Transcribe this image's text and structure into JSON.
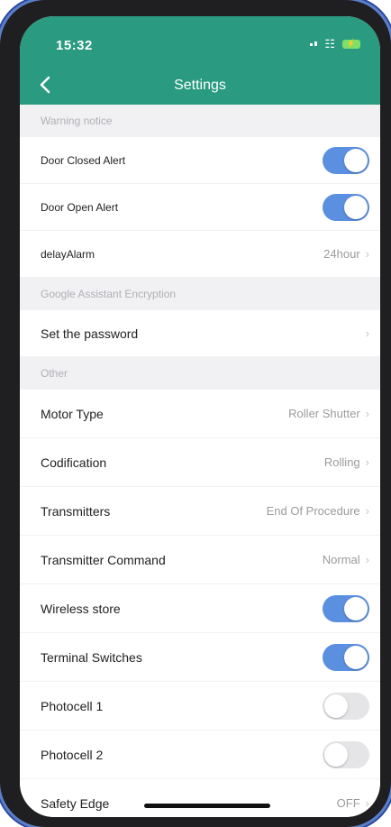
{
  "status": {
    "time": "15:32"
  },
  "header": {
    "title": "Settings"
  },
  "sections": {
    "warning": "Warning notice",
    "google": "Google Assistant Encryption",
    "other": "Other"
  },
  "rows": {
    "door_closed": {
      "label": "Door Closed Alert",
      "state": "on"
    },
    "door_open": {
      "label": "Door Open Alert",
      "state": "on"
    },
    "delay_alarm": {
      "label": "delayAlarm",
      "value": "24hour"
    },
    "set_password": {
      "label": "Set the password"
    },
    "motor_type": {
      "label": "Motor Type",
      "value": "Roller Shutter"
    },
    "codification": {
      "label": "Codification",
      "value": "Rolling"
    },
    "transmitters": {
      "label": "Transmitters",
      "value": "End Of Procedure"
    },
    "transmitter_command": {
      "label": "Transmitter Command",
      "value": "Normal"
    },
    "wireless_store": {
      "label": "Wireless store",
      "state": "on"
    },
    "terminal_switches": {
      "label": "Terminal Switches",
      "state": "on"
    },
    "photocell_1": {
      "label": "Photocell 1",
      "state": "off"
    },
    "photocell_2": {
      "label": "Photocell 2",
      "state": "off"
    },
    "safety_edge": {
      "label": "Safety Edge",
      "value": "OFF"
    }
  },
  "icons": {
    "back": "chevron-left-icon",
    "chevron": "chevron-right-icon",
    "signal": "signal-icon",
    "wifi": "wifi-icon",
    "battery": "battery-charging-icon"
  },
  "colors": {
    "header": "#2a9a80",
    "toggle_on": "#5b8fe0",
    "toggle_off": "#e5e5e7",
    "section_bg": "#f1f1f3"
  }
}
